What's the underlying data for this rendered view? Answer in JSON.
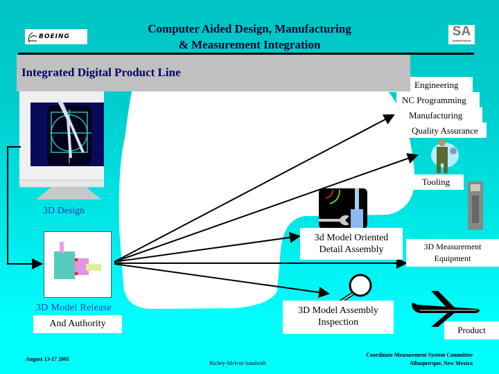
{
  "header": {
    "title_line1": "Computer Aided Design, Manufacturing",
    "title_line2": "& Measurement Integration",
    "left_logo": "BOEING",
    "right_logo": "SA",
    "right_logo_sub": "SpatialAnalyzer"
  },
  "banner": {
    "title": "Integrated Digital Product Line"
  },
  "nodes": {
    "design": "3D Design",
    "release_line1": "3D Model Release",
    "release_line2": "And Authority",
    "engineering": "Engineering",
    "nc_programming": "NC Programming",
    "manufacturing": "Manufacturing",
    "quality": "Quality Assurance",
    "tooling": "Tooling",
    "detail_line1": "3d Model Oriented",
    "detail_line2": "Detail Assembly",
    "measurement_line1": "3D Measurement",
    "measurement_line2": "Equipment",
    "inspection_line1": "3D Model Assembly",
    "inspection_line2": "Inspection",
    "product": "Product"
  },
  "footer": {
    "date": "August 13-17 2001",
    "authors": "Richey-McIvor-Sandwith",
    "committee": "Coordinate Measurement System Committee",
    "location": "Albuquerque, New Mexico"
  },
  "colors": {
    "banner_bg": "#c0c0c0",
    "banner_text": "#000066",
    "label_blue": "#1e3cb4",
    "bg_top": "#00c4c4",
    "bg_bottom": "#00ffff"
  }
}
